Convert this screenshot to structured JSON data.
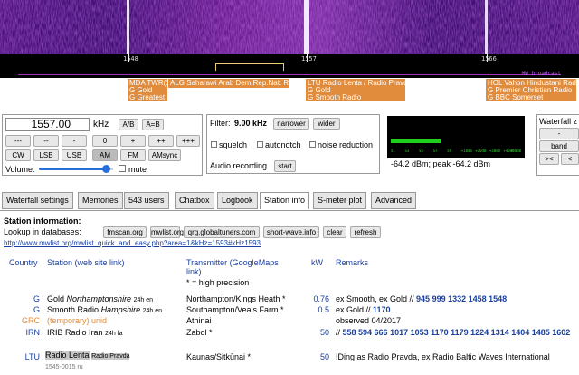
{
  "spectrum": {
    "freq_ticks": [
      "1548",
      "1557",
      "1566"
    ],
    "overlay_text": "MW broadcast",
    "station_labels": [
      [
        "MDA TWR(1",
        "G Gold",
        "G Greatest H"
      ],
      [
        "ALG Saharawi Arab Dem.Rep.Nat. Radio"
      ],
      [
        "LTU Radio Lenta / Radio Pravda",
        "G Gold",
        "G Smooth Radio"
      ],
      [
        "HOL Vahon Hindustani Radio",
        "G Premier Christian Radio",
        "G BBC Somerset"
      ]
    ],
    "colors": {
      "label_bg": "#e08c3c",
      "waterfall": "#3a0a6e"
    }
  },
  "tuner": {
    "frequency": "1557.00",
    "unit": "kHz",
    "ab": "A/B",
    "a_eq_b": "A=B",
    "step_buttons": [
      "---",
      "--",
      "-",
      "0",
      "+",
      "++",
      "+++"
    ],
    "modes": [
      "CW",
      "LSB",
      "USB",
      "AM",
      "FM",
      "AMsync"
    ],
    "selected_mode": "AM",
    "volume_label": "Volume:",
    "volume_level": 0.9,
    "mute": "mute"
  },
  "filter": {
    "label": "Filter:",
    "value": "9.00 kHz",
    "narrower": "narrower",
    "wider": "wider",
    "squelch": "squelch",
    "autonotch": "autonotch",
    "noise_reduction": "noise reduction",
    "recording_label": "Audio recording",
    "start": "start"
  },
  "smeter": {
    "scale": [
      "S1",
      "S3",
      "S5",
      "S7",
      "S9",
      "+10dB",
      "+20dB",
      "+30dB",
      "+40dB",
      "+50dB"
    ],
    "level": 0.38,
    "readout": "-64.2 dBm; peak  -64.2 dBm"
  },
  "waterfall_ctrl": {
    "title": "Waterfall z",
    "row1": "-",
    "row2": "band",
    "row3_left": "><",
    "row3_right": "<"
  },
  "tabs": [
    "Waterfall settings",
    "Memories",
    "543 users",
    "Chatbox",
    "Logbook",
    "Station info",
    "S-meter plot",
    "Advanced"
  ],
  "active_tab": "Station info",
  "station_info": {
    "heading": "Station information:",
    "lookup_label": "Lookup in databases:",
    "db_buttons": [
      "fmscan.org",
      "mwlist.org",
      "qrg.globaltuners.com",
      "short-wave.info",
      "clear",
      "refresh"
    ],
    "link": "http://www.mwlist.org/mwlist_quick_and_easy.php?area=1&kHz=1593#kHz1593",
    "columns": {
      "country": "Country",
      "station": "Station (web site link)",
      "transmitter": "Transmitter (GoogleMaps link)",
      "transmitter_note": "* = high precision",
      "kw": "kW",
      "remarks": "Remarks"
    },
    "rows": [
      {
        "country": "G",
        "station": "Gold",
        "region": "Northamptonshire",
        "hours": "24h en",
        "tx": "Northampton/Kings Heath *",
        "kw": "0.76",
        "rem_plain": "ex Smooth, ex Gold // ",
        "rem_freqs": "945 999 1332 1458 1548"
      },
      {
        "country": "G",
        "station": "Smooth Radio",
        "region": "Hampshire",
        "hours": "24h en",
        "tx": "Southampton/Veals Farm *",
        "kw": "0.5",
        "rem_plain": "ex Gold // ",
        "rem_freqs": "1170"
      },
      {
        "country": "GRC",
        "station": "(temporary) unid",
        "region": "",
        "hours": "",
        "tx": "Athinai",
        "kw": "",
        "rem_plain": "observed 04/2017",
        "rem_freqs": ""
      },
      {
        "country": "IRN",
        "station": "IRIB Radio Iran",
        "region": "",
        "hours": "24h fa",
        "tx": "Zabol *",
        "kw": "50",
        "rem_plain": "// ",
        "rem_freqs": "558 594 666 1017 1053 1170 1179 1224 1314 1404 1485 1602"
      },
      {
        "country": "LTU",
        "station": "Radio Lenta",
        "region": "Radio Pravda",
        "hours": "1545-0015 ru",
        "tx": "Kaunas/Sitkūnai *",
        "kw": "50",
        "rem_plain": "IDing as Radio Pravda, ex Radio Baltic Waves International",
        "rem_freqs": ""
      }
    ]
  }
}
